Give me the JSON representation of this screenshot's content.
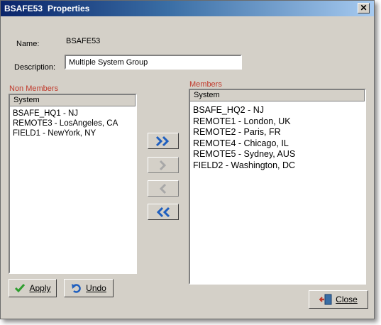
{
  "window": {
    "name": "BSAFE53",
    "title": "Properties",
    "close_symbol": "✕"
  },
  "form": {
    "name_label": "Name:",
    "name_value": "BSAFE53",
    "description_label": "Description:",
    "description_value": "Multiple System Group"
  },
  "non_members": {
    "label": "Non Members",
    "column": "System",
    "items": [
      "BSAFE_HQ1 - NJ",
      "REMOTE3 - LosAngeles, CA",
      "FIELD1 - NewYork, NY"
    ]
  },
  "members": {
    "label": "Members",
    "column": "System",
    "items": [
      "BSAFE_HQ2 - NJ",
      "REMOTE1 - London, UK",
      "REMOTE2 - Paris, FR",
      "REMOTE4 - Chicago, IL",
      "REMOTE5 - Sydney, AUS",
      "FIELD2 - Washington, DC"
    ]
  },
  "buttons": {
    "apply": "Apply",
    "undo": "Undo",
    "close": "Close"
  },
  "colors": {
    "accent_blue": "#1f5fbf",
    "group_label": "#c0392b"
  }
}
